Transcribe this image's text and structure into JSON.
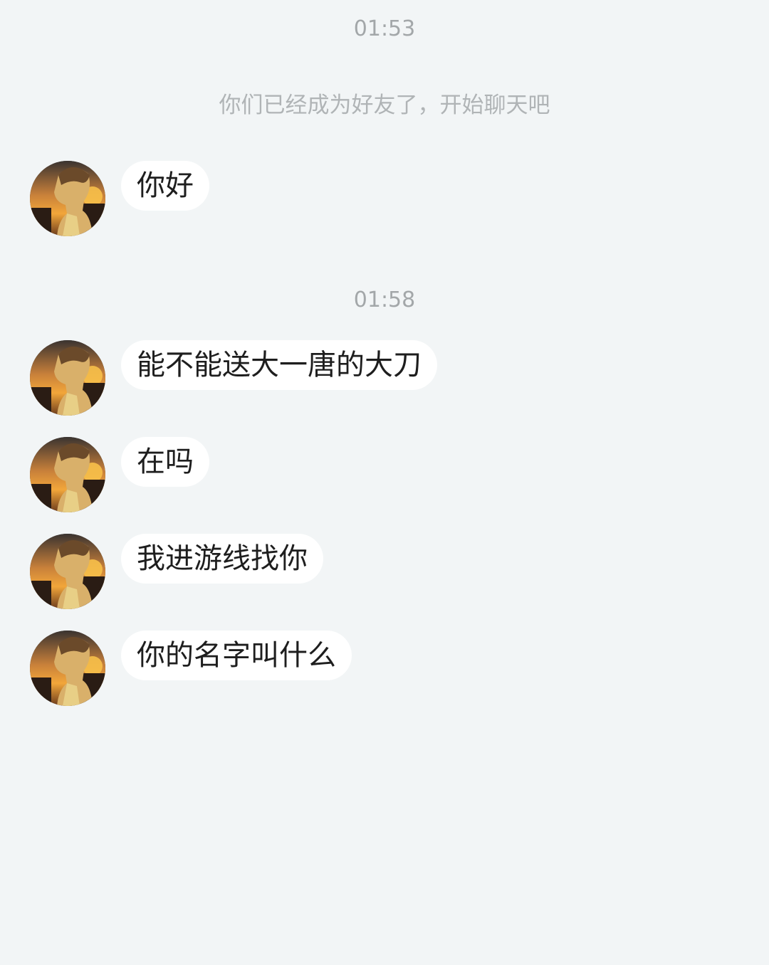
{
  "chat": {
    "timestamps": [
      "01:53",
      "01:58"
    ],
    "system_notice": "你们已经成为好友了，开始聊天吧",
    "messages": [
      {
        "text": "你好"
      },
      {
        "text": "能不能送大一唐的大刀"
      },
      {
        "text": "在吗"
      },
      {
        "text": "我进游线找你"
      },
      {
        "text": "你的名字叫什么"
      }
    ]
  },
  "colors": {
    "background": "#f2f5f6",
    "bubble": "#ffffff",
    "timestamp": "#a3a7a9",
    "notice": "#b0b4b6"
  },
  "icons": {
    "avatar": "anime-boy-sunset-avatar"
  }
}
